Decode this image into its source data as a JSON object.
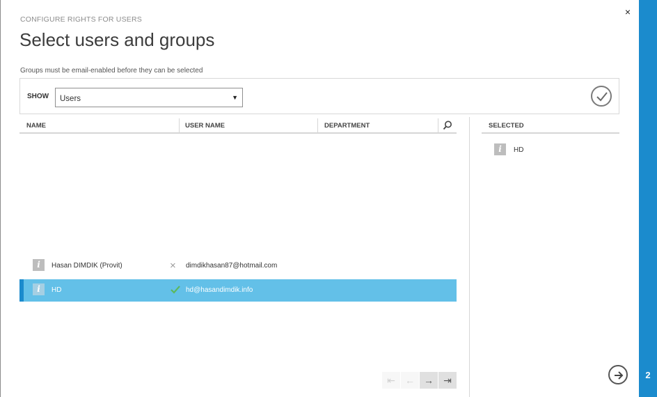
{
  "dialog": {
    "subtitle": "CONFIGURE RIGHTS FOR USERS",
    "title": "Select users and groups",
    "note": "Groups must be email-enabled before they can be selected",
    "close_glyph": "×",
    "step_number": "2"
  },
  "filter": {
    "show_label": "SHOW",
    "show_value": "Users",
    "caret_glyph": "▼"
  },
  "grid": {
    "columns": [
      "NAME",
      "USER NAME",
      "DEPARTMENT"
    ],
    "rows": [
      {
        "name": "Hasan DIMDIK (Provit)",
        "status": "x",
        "user_name": "dimdikhasan87@hotmail.com",
        "selected": false
      },
      {
        "name": "HD",
        "status": "ok",
        "user_name": "hd@hasandimdik.info",
        "selected": true
      }
    ]
  },
  "pager": {
    "first": "⇤",
    "prev": "←",
    "next": "→",
    "last": "⇥"
  },
  "selected_panel": {
    "header": "SELECTED",
    "items": [
      {
        "name": "HD"
      }
    ]
  },
  "icons": {
    "user": "user-info-icon",
    "status_x": "×",
    "info_glyph": "i"
  },
  "colors": {
    "accent": "#1b8bcd",
    "selected_row": "#63c0e8",
    "check_green": "#5cb85c"
  }
}
